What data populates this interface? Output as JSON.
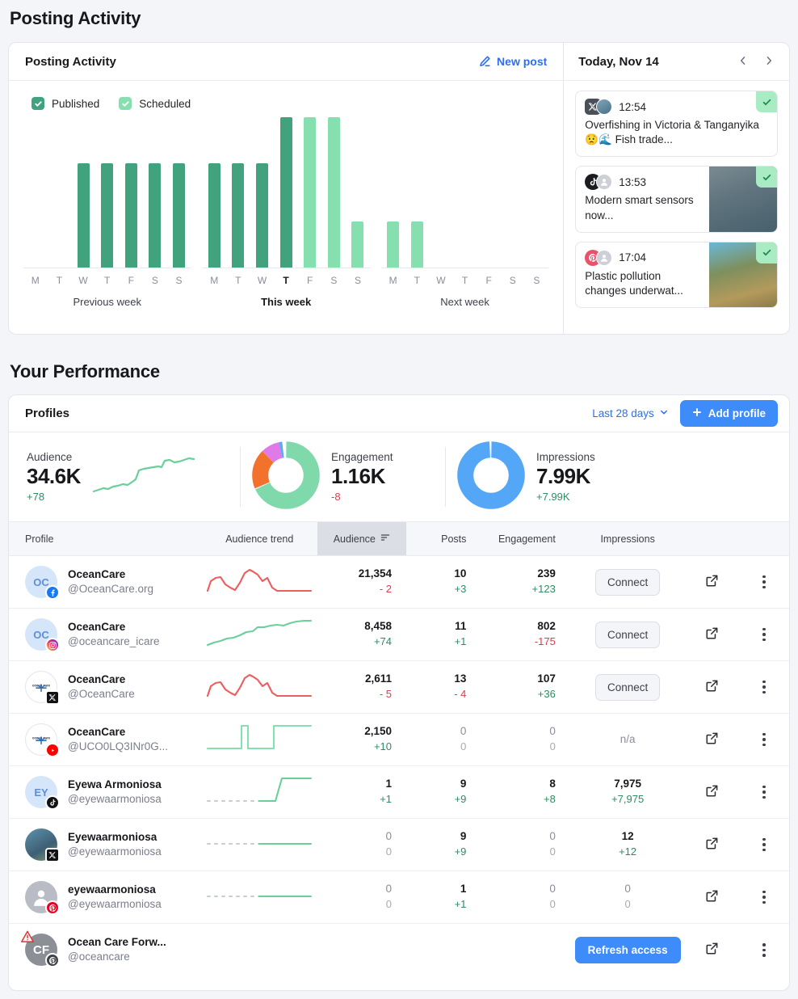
{
  "page": {
    "posting_section_title": "Posting Activity",
    "performance_section_title": "Your Performance"
  },
  "activity": {
    "card_title": "Posting Activity",
    "new_post_label": "New post",
    "legend": [
      {
        "label": "Published",
        "color": "#41a37d"
      },
      {
        "label": "Scheduled",
        "color": "#86dfae"
      }
    ]
  },
  "chart_data": {
    "type": "bar",
    "title": "Posting Activity",
    "xlabel": "",
    "ylabel": "",
    "ylim": [
      0,
      14
    ],
    "grid": false,
    "legend_position": "top-left",
    "categories": [
      "M",
      "T",
      "W",
      "T",
      "F",
      "S",
      "S"
    ],
    "groups": [
      {
        "name": "Previous week",
        "current": false,
        "days": [
          {
            "day": "M",
            "published": 0,
            "scheduled": 0,
            "today": false
          },
          {
            "day": "T",
            "published": 0,
            "scheduled": 0,
            "today": false
          },
          {
            "day": "W",
            "published": 9,
            "scheduled": 0,
            "today": false
          },
          {
            "day": "T",
            "published": 9,
            "scheduled": 0,
            "today": false
          },
          {
            "day": "F",
            "published": 9,
            "scheduled": 0,
            "today": false
          },
          {
            "day": "S",
            "published": 9,
            "scheduled": 0,
            "today": false
          },
          {
            "day": "S",
            "published": 9,
            "scheduled": 0,
            "today": false
          }
        ]
      },
      {
        "name": "This week",
        "current": true,
        "days": [
          {
            "day": "M",
            "published": 9,
            "scheduled": 0,
            "today": false
          },
          {
            "day": "T",
            "published": 9,
            "scheduled": 0,
            "today": false
          },
          {
            "day": "W",
            "published": 9,
            "scheduled": 0,
            "today": false
          },
          {
            "day": "T",
            "published": 13,
            "scheduled": 0,
            "today": true
          },
          {
            "day": "F",
            "published": 0,
            "scheduled": 13,
            "today": false
          },
          {
            "day": "S",
            "published": 0,
            "scheduled": 13,
            "today": false
          },
          {
            "day": "S",
            "published": 0,
            "scheduled": 4,
            "today": false
          }
        ]
      },
      {
        "name": "Next week",
        "current": false,
        "days": [
          {
            "day": "M",
            "published": 0,
            "scheduled": 4,
            "today": false
          },
          {
            "day": "T",
            "published": 0,
            "scheduled": 4,
            "today": false
          },
          {
            "day": "W",
            "published": 0,
            "scheduled": 0,
            "today": false
          },
          {
            "day": "T",
            "published": 0,
            "scheduled": 0,
            "today": false
          },
          {
            "day": "F",
            "published": 0,
            "scheduled": 0,
            "today": false
          },
          {
            "day": "S",
            "published": 0,
            "scheduled": 0,
            "today": false
          },
          {
            "day": "S",
            "published": 0,
            "scheduled": 0,
            "today": false
          }
        ]
      }
    ]
  },
  "today": {
    "title": "Today, Nov 14",
    "posts": [
      {
        "time": "12:54",
        "text": "Overfishing in Victoria & Tanganyika 😟🌊 Fish trade...",
        "network": "x",
        "has_image": false,
        "status": "published"
      },
      {
        "time": "13:53",
        "text": "Modern smart sensors now...",
        "network": "tiktok",
        "has_image": true,
        "status": "published"
      },
      {
        "time": "17:04",
        "text": "Plastic pollution changes underwat...",
        "network": "pinterest",
        "has_image": true,
        "status": "published"
      }
    ]
  },
  "profiles": {
    "card_title": "Profiles",
    "range_label": "Last 28 days",
    "add_profile_label": "Add profile",
    "kpis": [
      {
        "label": "Audience",
        "value": "34.6K",
        "delta": "+78",
        "direction": "up",
        "viz": "sparkline"
      },
      {
        "label": "Engagement",
        "value": "1.16K",
        "delta": "-8",
        "direction": "down",
        "viz": "donut"
      },
      {
        "label": "Impressions",
        "value": "7.99K",
        "delta": "+7.99K",
        "direction": "up",
        "viz": "donut"
      }
    ],
    "columns": [
      "Profile",
      "Audience trend",
      "Audience",
      "Posts",
      "Engagement",
      "Impressions"
    ],
    "sorted_column": "Audience",
    "rows": [
      {
        "name": "OceanCare",
        "handle": "@OceanCare.org",
        "network": "facebook",
        "avatar_type": "initials",
        "initials": "OC",
        "trend": "down",
        "audience": "21,354",
        "audience_delta": "- 2",
        "audience_dir": "down",
        "posts": "10",
        "posts_delta": "+3",
        "posts_dir": "up",
        "engagement": "239",
        "engagement_delta": "+123",
        "engagement_dir": "up",
        "impressions_action": "Connect"
      },
      {
        "name": "OceanCare",
        "handle": "@oceancare_icare",
        "network": "instagram",
        "avatar_type": "initials",
        "initials": "OC",
        "trend": "up",
        "audience": "8,458",
        "audience_delta": "+74",
        "audience_dir": "up",
        "posts": "11",
        "posts_delta": "+1",
        "posts_dir": "up",
        "engagement": "802",
        "engagement_delta": "-175",
        "engagement_dir": "down",
        "impressions_action": "Connect"
      },
      {
        "name": "OceanCare",
        "handle": "@OceanCare",
        "network": "x",
        "avatar_type": "logo",
        "initials": "",
        "trend": "down",
        "audience": "2,611",
        "audience_delta": "- 5",
        "audience_dir": "down",
        "posts": "13",
        "posts_delta": "- 4",
        "posts_dir": "down",
        "engagement": "107",
        "engagement_delta": "+36",
        "engagement_dir": "up",
        "impressions_action": "Connect"
      },
      {
        "name": "OceanCare",
        "handle": "@UCO0LQ3INr0G...",
        "network": "youtube",
        "avatar_type": "logo",
        "initials": "",
        "trend": "step",
        "audience": "2,150",
        "audience_delta": "+10",
        "audience_dir": "up",
        "posts": "0",
        "posts_delta": "0",
        "posts_dir": "zero",
        "engagement": "0",
        "engagement_delta": "0",
        "engagement_dir": "zero",
        "impressions": "n/a",
        "impressions_na": true
      },
      {
        "name": "Eyewa Armoniosa",
        "handle": "@eyewaarmoniosa",
        "network": "tiktok",
        "avatar_type": "initials",
        "initials": "EY",
        "trend": "rise",
        "audience": "1",
        "audience_delta": "+1",
        "audience_dir": "up",
        "posts": "9",
        "posts_delta": "+9",
        "posts_dir": "up",
        "engagement": "8",
        "engagement_delta": "+8",
        "engagement_dir": "up",
        "impressions": "7,975",
        "impressions_delta": "+7,975",
        "impressions_dir": "up"
      },
      {
        "name": "Eyewaarmoniosa",
        "handle": "@eyewaarmoniosa",
        "network": "x",
        "avatar_type": "photo",
        "initials": "",
        "trend": "flat",
        "audience": "0",
        "audience_delta": "0",
        "audience_dir": "zero",
        "posts": "9",
        "posts_delta": "+9",
        "posts_dir": "up",
        "engagement": "0",
        "engagement_delta": "0",
        "engagement_dir": "zero",
        "impressions": "12",
        "impressions_delta": "+12",
        "impressions_dir": "up"
      },
      {
        "name": "eyewaarmoniosa",
        "handle": "@eyewaarmoniosa",
        "network": "pinterest",
        "avatar_type": "person",
        "initials": "",
        "trend": "flat",
        "audience": "0",
        "audience_delta": "0",
        "audience_dir": "zero",
        "posts": "1",
        "posts_delta": "+1",
        "posts_dir": "up",
        "engagement": "0",
        "engagement_delta": "0",
        "engagement_dir": "zero",
        "impressions": "0",
        "impressions_delta": "0",
        "impressions_dir": "zero"
      },
      {
        "name": "Ocean Care Forw...",
        "handle": "@oceancare",
        "network": "pinterest-gray",
        "avatar_type": "ocf",
        "initials": "CF",
        "warning": true,
        "trend": "none",
        "audience": "",
        "audience_delta": "",
        "audience_dir": "",
        "posts": "",
        "posts_delta": "",
        "posts_dir": "",
        "engagement": "",
        "engagement_delta": "",
        "engagement_dir": "",
        "impressions_action": "Refresh access",
        "refresh": true
      }
    ]
  },
  "colors": {
    "published": "#41a37d",
    "scheduled": "#86dfae",
    "accent_blue": "#3e8bfa",
    "link_blue": "#2f6fed",
    "up_green": "#2e8c61",
    "down_red": "#d6414e"
  }
}
